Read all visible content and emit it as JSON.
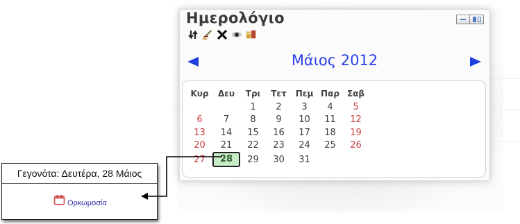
{
  "calendar": {
    "title": "Ημερολόγιο",
    "toolbar": [
      "move-icon",
      "edit-icon",
      "delete-icon",
      "hide-icon",
      "roles-icon"
    ],
    "month_label": "Μάιος 2012",
    "weekdays": [
      "Κυρ",
      "Δευ",
      "Τρι",
      "Τετ",
      "Πεμ",
      "Παρ",
      "Σαβ"
    ],
    "weeks": [
      [
        "",
        "",
        "1",
        "2",
        "3",
        "4",
        "5"
      ],
      [
        "6",
        "7",
        "8",
        "9",
        "10",
        "11",
        "12"
      ],
      [
        "13",
        "14",
        "15",
        "16",
        "17",
        "18",
        "19"
      ],
      [
        "20",
        "21",
        "22",
        "23",
        "24",
        "25",
        "26"
      ],
      [
        "27",
        "28",
        "29",
        "30",
        "31",
        "",
        ""
      ]
    ],
    "highlighted_day": "28",
    "weekend_color": "#cc3b3b",
    "accent_color": "#2a3fe8"
  },
  "events": {
    "header": "Γεγονότα: Δευτέρα, 28 Μάιος",
    "items": [
      {
        "icon": "calendar-event-icon",
        "name": "Ορκωμοσία"
      }
    ]
  }
}
